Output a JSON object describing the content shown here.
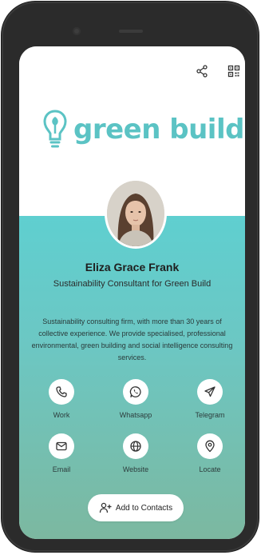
{
  "brand": {
    "name": "green build",
    "color": "#5bc3c4"
  },
  "header": {
    "share_icon": "share-icon",
    "qr_icon": "qr-code-icon"
  },
  "profile": {
    "name": "Eliza Grace Frank",
    "title": "Sustainability Consultant for Green Build",
    "bio": "Sustainability consulting firm, with more than 30 years of collective experience. We provide specialised, professional environmental, green building and social intelligence consulting services."
  },
  "actions": [
    {
      "label": "Work",
      "icon": "phone-icon"
    },
    {
      "label": "Whatsapp",
      "icon": "whatsapp-icon"
    },
    {
      "label": "Telegram",
      "icon": "telegram-icon"
    },
    {
      "label": "Email",
      "icon": "email-icon"
    },
    {
      "label": "Website",
      "icon": "globe-icon"
    },
    {
      "label": "Locate",
      "icon": "location-icon"
    }
  ],
  "add_contact": {
    "label": "Add to Contacts",
    "icon": "add-user-icon"
  },
  "colors": {
    "gradient_top": "#5fcfd0",
    "gradient_bottom": "#7cb8a0"
  }
}
